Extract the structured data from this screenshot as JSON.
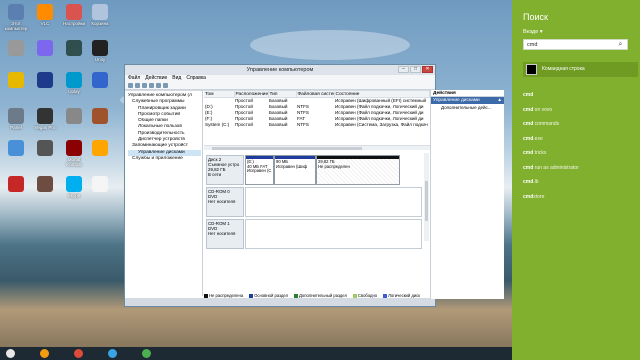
{
  "desktop": {
    "icons": [
      {
        "label": "Этот компьютер",
        "color": "#5a7fb0"
      },
      {
        "label": "VLC",
        "color": "#ff8c00"
      },
      {
        "label": "Настройки",
        "color": "#d9534f"
      },
      {
        "label": "Корзина",
        "color": "#b0c4de"
      },
      {
        "label": "",
        "color": "#999"
      },
      {
        "label": "",
        "color": "#7b68ee"
      },
      {
        "label": "",
        "color": "#2f4f4f"
      },
      {
        "label": "Unity",
        "color": "#222"
      },
      {
        "label": "",
        "color": "#e6b800"
      },
      {
        "label": "",
        "color": "#1e3a8a"
      },
      {
        "label": "Uplay",
        "color": "#0099cc"
      },
      {
        "label": "",
        "color": "#3366cc"
      },
      {
        "label": "Panel",
        "color": "#6c7a89"
      },
      {
        "label": "Vegas Pro",
        "color": "#333"
      },
      {
        "label": "",
        "color": "#888"
      },
      {
        "label": "",
        "color": "#a0522d"
      },
      {
        "label": "",
        "color": "#4a90d9"
      },
      {
        "label": "",
        "color": "#555"
      },
      {
        "label": "Mortal Kombat",
        "color": "#8b0000"
      },
      {
        "label": "",
        "color": "#ffa500"
      },
      {
        "label": "",
        "color": "#c62828"
      },
      {
        "label": "",
        "color": "#6d4c41"
      },
      {
        "label": "Skype",
        "color": "#00aff0"
      },
      {
        "label": "",
        "color": "#f5f5f5"
      }
    ],
    "taskbar_items": [
      "#e8e8e8",
      "#f39c12",
      "#dd4b39",
      "#3aa3e3",
      "#4caf50"
    ]
  },
  "window": {
    "title": "Управление компьютером",
    "controls": {
      "minimize": "–",
      "maximize": "□",
      "close": "✕"
    },
    "menu": [
      "Файл",
      "Действие",
      "Вид",
      "Справка"
    ],
    "tree": [
      {
        "label": "Управление компьютером (л",
        "level": 0,
        "selected": false
      },
      {
        "label": "Служебные программы",
        "level": 1,
        "selected": false
      },
      {
        "label": "Планировщик задани",
        "level": 2,
        "selected": false
      },
      {
        "label": "Просмотр событий",
        "level": 2,
        "selected": false
      },
      {
        "label": "Общие папки",
        "level": 2,
        "selected": false
      },
      {
        "label": "Локальные пользов",
        "level": 2,
        "selected": false
      },
      {
        "label": "Производительность",
        "level": 2,
        "selected": false
      },
      {
        "label": "Диспетчер устройств",
        "level": 2,
        "selected": false
      },
      {
        "label": "Запоминающие устройст",
        "level": 1,
        "selected": false
      },
      {
        "label": "Управление дисками",
        "level": 2,
        "selected": true
      },
      {
        "label": "Службы и приложение",
        "level": 1,
        "selected": false
      }
    ],
    "volume_table": {
      "headers": [
        "Том",
        "Расположение",
        "Тип",
        "Файловая система",
        "Состояние"
      ],
      "rows": [
        [
          "",
          "Простой",
          "Базовый",
          "",
          "Исправен (Шифрованный (EFI) системный"
        ],
        [
          "(D:)",
          "Простой",
          "Базовый",
          "NTFS",
          "Исправен (Файл подкачки, Логический ди"
        ],
        [
          "(E:)",
          "Простой",
          "Базовый",
          "NTFS",
          "Исправен (Файл подкачки, Логический ди"
        ],
        [
          "(F:)",
          "Простой",
          "Базовый",
          "FAT",
          "Исправен (Файл подкачки, Логический ди"
        ],
        [
          "System (C:)",
          "Простой",
          "Базовый",
          "NTFS",
          "Исправен (Система, Загрузка, Файл подкач"
        ]
      ]
    },
    "disks": [
      {
        "name": "Диск 2",
        "info": [
          "Съемное устро",
          "29,82 ГБ",
          "В сети"
        ],
        "partitions": [
          {
            "title": "(E:)",
            "lines": [
              "40 МБ FAT",
              "Исправен (С"
            ],
            "color": "#1f3c9c"
          },
          {
            "title": "",
            "lines": [
              "90 МБ",
              "Исправен (Шиф"
            ],
            "color": "#1f3c9c"
          },
          {
            "title": "",
            "lines": [
              "29,82 ГБ",
              "Не распределен"
            ],
            "color": "#111111"
          }
        ]
      },
      {
        "name": "CD-ROM 0",
        "info": [
          "DVD",
          "",
          "Нет носителя"
        ],
        "partitions": []
      },
      {
        "name": "CD-ROM 1",
        "info": [
          "DVD",
          "",
          "Нет носителя"
        ],
        "partitions": []
      }
    ],
    "legend": [
      {
        "label": "Не распределена",
        "color": "#111111"
      },
      {
        "label": "Основной раздел",
        "color": "#1f3c9c"
      },
      {
        "label": "Дополнительный раздел",
        "color": "#2e7d32"
      },
      {
        "label": "Свободно",
        "color": "#9ccc65"
      },
      {
        "label": "Логический диск",
        "color": "#3b5bdb"
      }
    ],
    "actions": {
      "header": "Действия",
      "selected": "Управление дисками",
      "sub": "Дополнительные дейс..."
    }
  },
  "charm": {
    "title": "Поиск",
    "scope": "Везде",
    "query": "cmd",
    "top_hit": "Командная строка",
    "suggestions": [
      {
        "bold": "cmd",
        "rest": ""
      },
      {
        "bold": "cmd",
        "rest": " on vovo"
      },
      {
        "bold": "cmd",
        "rest": " commands"
      },
      {
        "bold": "cmd",
        "rest": ".exe"
      },
      {
        "bold": "cmd",
        "rest": " tricks"
      },
      {
        "bold": "cmd",
        "rest": " run as administrator"
      },
      {
        "bold": "cmd",
        "rest": ".lb"
      },
      {
        "bold": "cmd",
        "rest": "store"
      }
    ]
  }
}
